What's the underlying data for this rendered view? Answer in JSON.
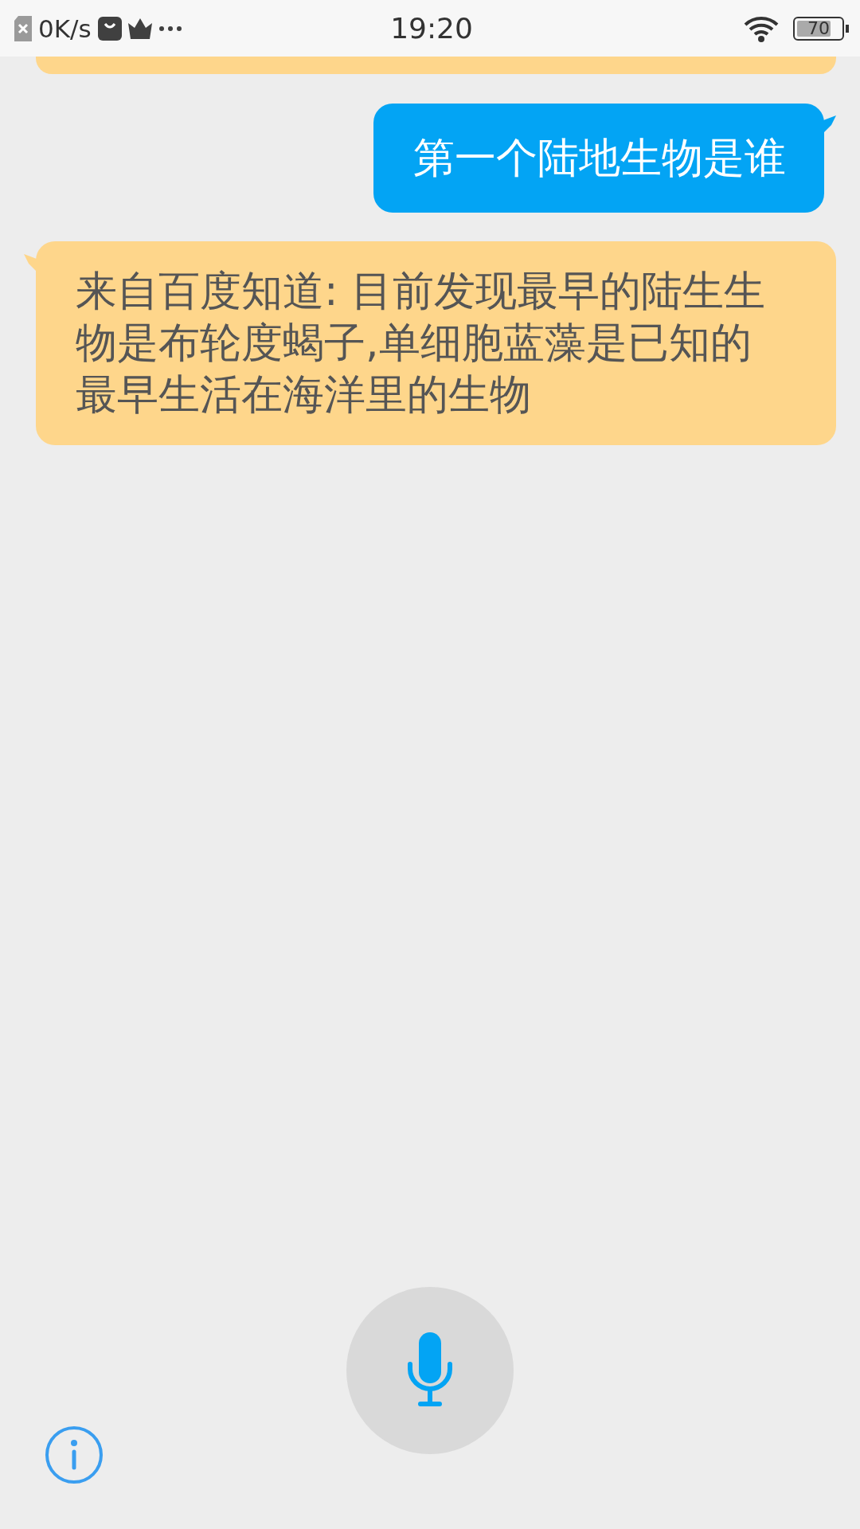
{
  "status_bar": {
    "speed": "0K/s",
    "time": "19:20",
    "battery": "70"
  },
  "messages": [
    {
      "kind": "user",
      "text": "第一个陆地生物是谁"
    },
    {
      "kind": "bot",
      "text": "来自百度知道: 目前发现最早的陆生生物是布轮度蝎子,单细胞蓝藻是已知的最早生活在海洋里的生物"
    }
  ]
}
